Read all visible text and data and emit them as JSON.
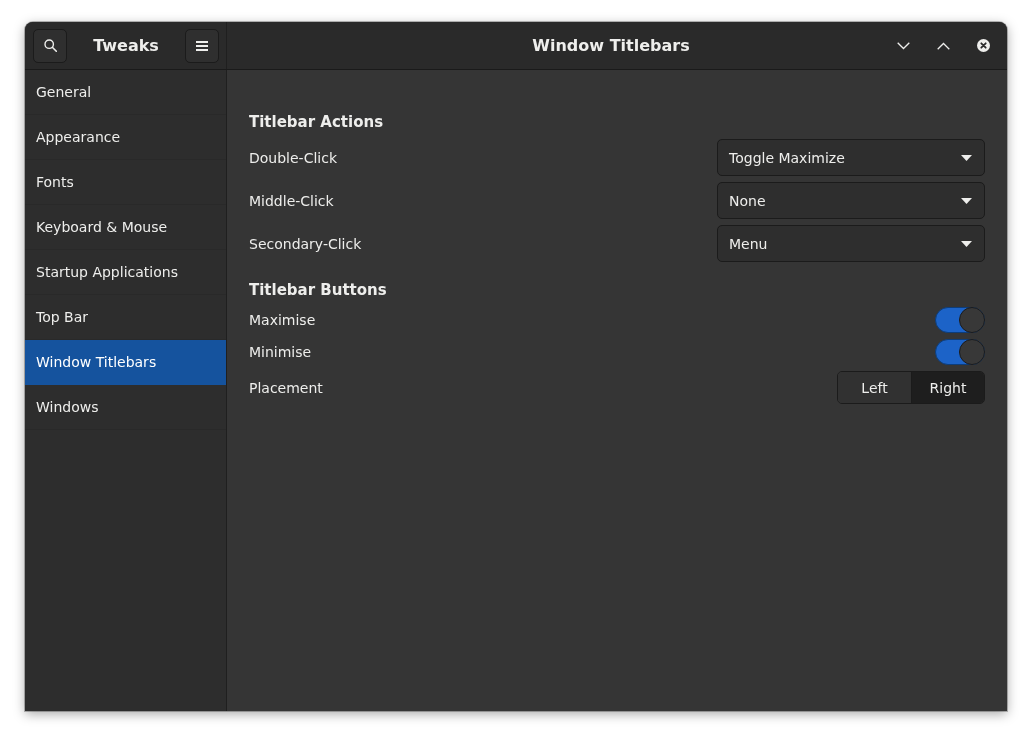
{
  "header": {
    "app_title": "Tweaks",
    "title": "Window Titlebars"
  },
  "sidebar": {
    "items": [
      {
        "label": "General",
        "selected": false
      },
      {
        "label": "Appearance",
        "selected": false
      },
      {
        "label": "Fonts",
        "selected": false
      },
      {
        "label": "Keyboard & Mouse",
        "selected": false
      },
      {
        "label": "Startup Applications",
        "selected": false
      },
      {
        "label": "Top Bar",
        "selected": false
      },
      {
        "label": "Window Titlebars",
        "selected": true
      },
      {
        "label": "Windows",
        "selected": false
      }
    ]
  },
  "sections": [
    {
      "heading": "Titlebar Actions",
      "rows": [
        {
          "kind": "dropdown",
          "label": "Double-Click",
          "value": "Toggle Maximize"
        },
        {
          "kind": "dropdown",
          "label": "Middle-Click",
          "value": "None"
        },
        {
          "kind": "dropdown",
          "label": "Secondary-Click",
          "value": "Menu"
        }
      ]
    },
    {
      "heading": "Titlebar Buttons",
      "rows": [
        {
          "kind": "switch",
          "label": "Maximise",
          "on": true
        },
        {
          "kind": "switch",
          "label": "Minimise",
          "on": true
        },
        {
          "kind": "segmented",
          "label": "Placement",
          "options": [
            {
              "label": "Left",
              "selected": false
            },
            {
              "label": "Right",
              "selected": true
            }
          ]
        }
      ]
    }
  ]
}
